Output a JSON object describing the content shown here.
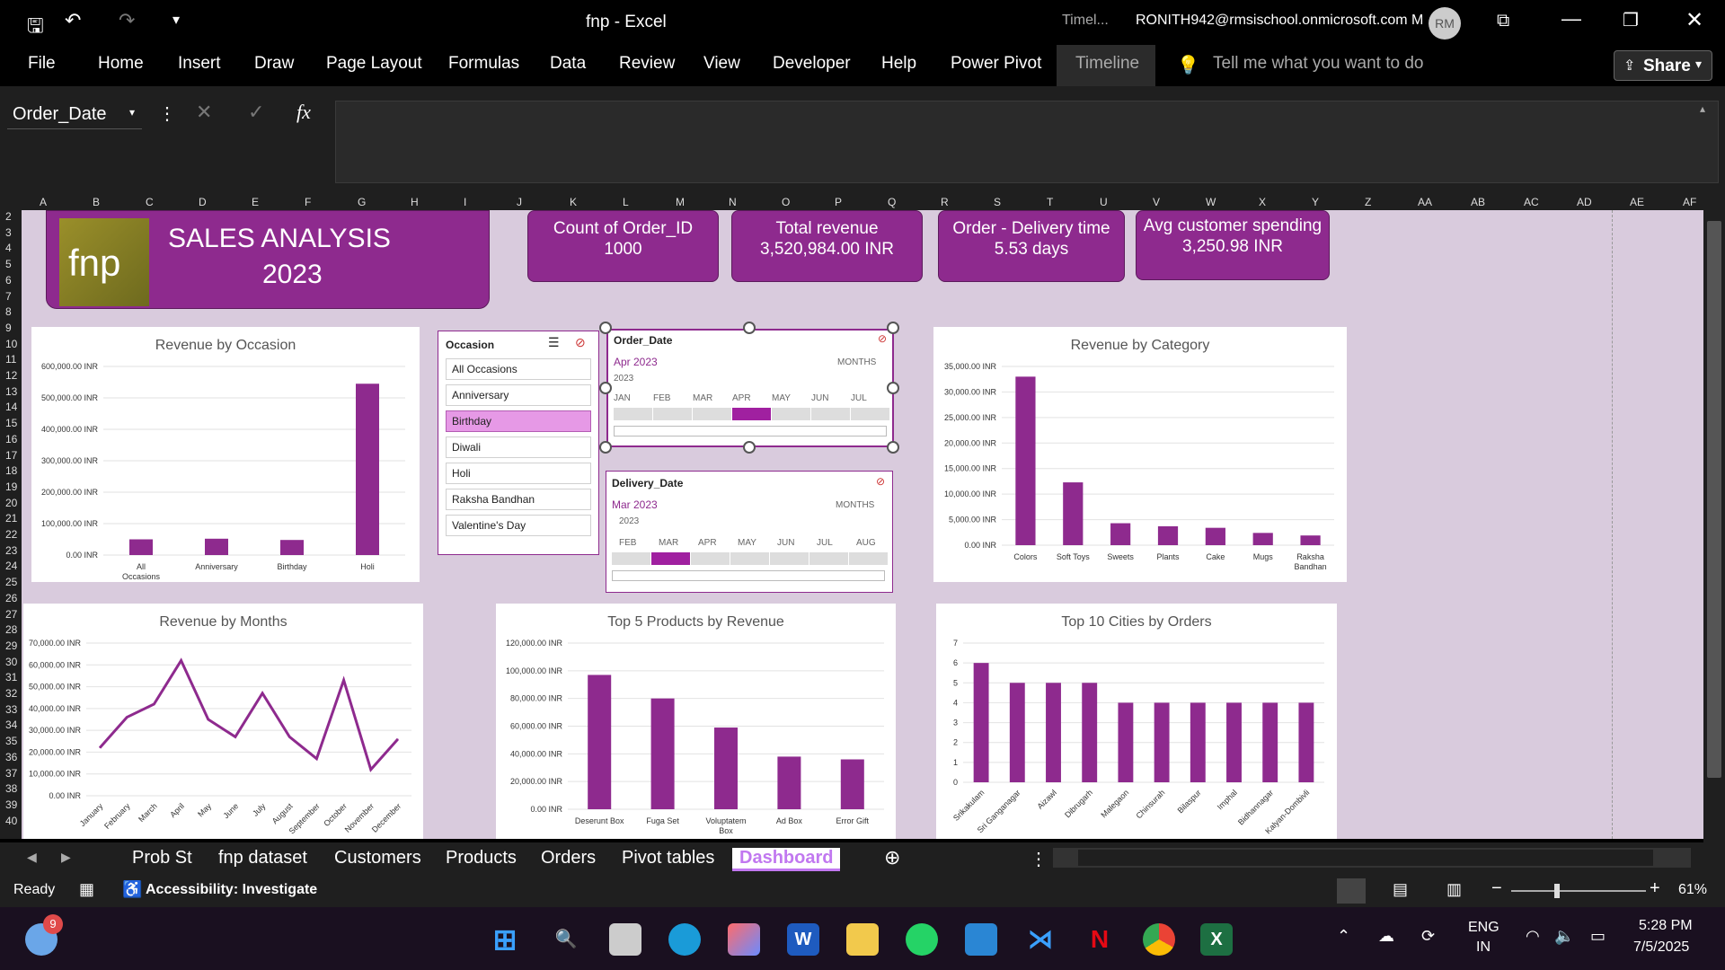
{
  "window": {
    "title": "fnp  -  Excel",
    "account": "RONITH942@rmsischool.onmicrosoft.com M",
    "avatar": "RM",
    "context_tab": "Timel..."
  },
  "ribbon": {
    "tabs": [
      "File",
      "Home",
      "Insert",
      "Draw",
      "Page Layout",
      "Formulas",
      "Data",
      "Review",
      "View",
      "Developer",
      "Help",
      "Power Pivot",
      "Timeline"
    ],
    "tell_me": "Tell me what you want to do",
    "share": "Share"
  },
  "formula_bar": {
    "name_box": "Order_Date",
    "fx": "fx"
  },
  "columns": [
    "A",
    "B",
    "C",
    "D",
    "E",
    "F",
    "G",
    "H",
    "I",
    "J",
    "K",
    "L",
    "M",
    "N",
    "O",
    "P",
    "Q",
    "R",
    "S",
    "T",
    "U",
    "V",
    "W",
    "X",
    "Y",
    "Z",
    "AA",
    "AB",
    "AC",
    "AD",
    "AE",
    "AF"
  ],
  "rows": [
    "2",
    "3",
    "4",
    "5",
    "6",
    "7",
    "8",
    "9",
    "10",
    "11",
    "12",
    "13",
    "14",
    "15",
    "16",
    "17",
    "18",
    "19",
    "20",
    "21",
    "22",
    "23",
    "24",
    "25",
    "26",
    "27",
    "28",
    "29",
    "30",
    "31",
    "32",
    "33",
    "34",
    "35",
    "36",
    "37",
    "38",
    "39",
    "40"
  ],
  "header": {
    "title_line1": "SALES ANALYSIS",
    "title_line2": "2023",
    "logo": "fnp"
  },
  "kpis": [
    {
      "label": "Count of Order_ID",
      "value": "1000"
    },
    {
      "label": "Total revenue",
      "value": "3,520,984.00 INR"
    },
    {
      "label": "Order - Delivery time",
      "value": "5.53 days"
    },
    {
      "label": "Avg customer spending",
      "value": "3,250.98 INR"
    }
  ],
  "occasion_slicer": {
    "title": "Occasion",
    "items": [
      "All Occasions",
      "Anniversary",
      "Birthday",
      "Diwali",
      "Holi",
      "Raksha Bandhan",
      "Valentine's Day"
    ],
    "selected": "Birthday"
  },
  "order_timeline": {
    "title": "Order_Date",
    "selection": "Apr 2023",
    "level": "MONTHS",
    "year": "2023",
    "months": [
      "JAN",
      "FEB",
      "MAR",
      "APR",
      "MAY",
      "JUN",
      "JUL"
    ],
    "selected_month": "APR"
  },
  "delivery_timeline": {
    "title": "Delivery_Date",
    "selection": "Mar 2023",
    "level": "MONTHS",
    "year": "2023",
    "months": [
      "FEB",
      "MAR",
      "APR",
      "MAY",
      "JUN",
      "JUL",
      "AUG"
    ],
    "selected_month": "MAR"
  },
  "chart_data": [
    {
      "id": "occasion",
      "type": "bar",
      "title": "Revenue by Occasion",
      "categories": [
        "All Occasions",
        "Anniversary",
        "Birthday",
        "Holi"
      ],
      "values": [
        50000,
        52000,
        48000,
        545000
      ],
      "ylim": [
        0,
        600000
      ],
      "yticks": [
        "600,000.00 INR",
        "500,000.00 INR",
        "400,000.00 INR",
        "300,000.00 INR",
        "200,000.00 INR",
        "100,000.00 INR",
        "0.00 INR"
      ]
    },
    {
      "id": "category",
      "type": "bar",
      "title": "Revenue by Category",
      "categories": [
        "Colors",
        "Soft Toys",
        "Sweets",
        "Plants",
        "Cake",
        "Mugs",
        "Raksha Bandhan"
      ],
      "values": [
        33000,
        12300,
        4300,
        3700,
        3400,
        2400,
        1900
      ],
      "ylim": [
        0,
        35000
      ],
      "yticks": [
        "35,000.00 INR",
        "30,000.00 INR",
        "25,000.00 INR",
        "20,000.00 INR",
        "15,000.00 INR",
        "10,000.00 INR",
        "5,000.00 INR",
        "0.00 INR"
      ]
    },
    {
      "id": "months",
      "type": "line",
      "title": "Revenue by Months",
      "categories": [
        "January",
        "February",
        "March",
        "April",
        "May",
        "June",
        "July",
        "August",
        "September",
        "October",
        "November",
        "December"
      ],
      "values": [
        22000,
        36000,
        42000,
        62000,
        35000,
        27000,
        47000,
        27000,
        17000,
        53000,
        12000,
        26000
      ],
      "ylim": [
        0,
        70000
      ],
      "yticks": [
        "70,000.00 INR",
        "60,000.00 INR",
        "50,000.00 INR",
        "40,000.00 INR",
        "30,000.00 INR",
        "20,000.00 INR",
        "10,000.00 INR",
        "0.00 INR"
      ]
    },
    {
      "id": "products",
      "type": "bar",
      "title": "Top 5 Products by Revenue",
      "categories": [
        "Deserunt Box",
        "Fuga Set",
        "Voluptatem Box",
        "Ad Box",
        "Error Gift"
      ],
      "values": [
        97000,
        80000,
        59000,
        38000,
        36000
      ],
      "ylim": [
        0,
        120000
      ],
      "yticks": [
        "120,000.00 INR",
        "100,000.00 INR",
        "80,000.00 INR",
        "60,000.00 INR",
        "40,000.00 INR",
        "20,000.00 INR",
        "0.00 INR"
      ]
    },
    {
      "id": "cities",
      "type": "bar",
      "title": "Top 10 Cities by Orders",
      "categories": [
        "Srikakulam",
        "Sri Ganganagar",
        "Aizawl",
        "Dibrugarh",
        "Malegaon",
        "Chinsurah",
        "Bilaspur",
        "Imphal",
        "Bidhannagar",
        "Kalyan-Dombivli"
      ],
      "values": [
        6,
        5,
        5,
        5,
        4,
        4,
        4,
        4,
        4,
        4
      ],
      "ylim": [
        0,
        7
      ],
      "yticks": [
        "7",
        "6",
        "5",
        "4",
        "3",
        "2",
        "1",
        "0"
      ]
    }
  ],
  "sheet_tabs": [
    "Prob St",
    "fnp dataset",
    "Customers",
    "Products",
    "Orders",
    "Pivot tables",
    "Dashboard"
  ],
  "active_tab": "Dashboard",
  "status": {
    "ready": "Ready",
    "accessibility": "Accessibility: Investigate",
    "zoom": "61%"
  },
  "taskbar": {
    "weather_badge": "9",
    "lang1": "ENG",
    "lang2": "IN",
    "time": "5:28 PM",
    "date": "7/5/2025"
  }
}
